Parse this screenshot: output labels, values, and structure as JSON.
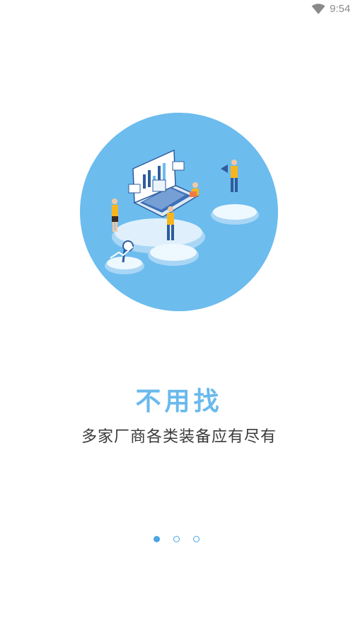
{
  "status_bar": {
    "time": "9:54",
    "wifi_icon": "wifi-icon"
  },
  "onboarding": {
    "headline": "不用找",
    "subtitle": "多家厂商各类装备应有尽有",
    "page_indicator": {
      "total": 3,
      "current": 1
    }
  },
  "colors": {
    "accent": "#6ab9ec",
    "circle": "#6cbcee",
    "dot": "#4aa6e6",
    "text": "#3a3a3a"
  }
}
